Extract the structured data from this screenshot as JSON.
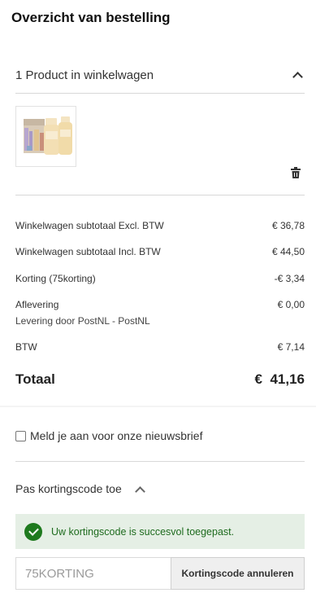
{
  "summary": {
    "title": "Overzicht van bestelling",
    "cart_header": "1 Product in winkelwagen"
  },
  "icons": {
    "collapse": "chevron-up-icon",
    "delete": "trash-icon",
    "success": "check-circle-icon"
  },
  "totals": {
    "rows": [
      {
        "label": "Winkelwagen subtotaal Excl. BTW",
        "value": "€ 36,78"
      },
      {
        "label": "Winkelwagen subtotaal Incl. BTW",
        "value": "€ 44,50"
      },
      {
        "label": "Korting (75korting)",
        "value": "-€ 3,34"
      },
      {
        "label": "Aflevering",
        "sub": "Levering door PostNL - PostNL",
        "value": "€ 0,00"
      },
      {
        "label": "BTW",
        "value": "€ 7,14"
      }
    ],
    "total_label": "Totaal",
    "total_value": "€  41,16"
  },
  "newsletter": {
    "label": "Meld je aan voor onze nieuwsbrief",
    "checked": false
  },
  "discount": {
    "header": "Pas kortingscode toe",
    "success_message": "Uw kortingscode is succesvol toegepast.",
    "code_value": "75KORTING",
    "cancel_label": "Kortingscode annuleren"
  },
  "colors": {
    "success_bg": "#e5efe5",
    "success_icon": "#1e7a1e",
    "success_text": "#1e6b1e"
  }
}
